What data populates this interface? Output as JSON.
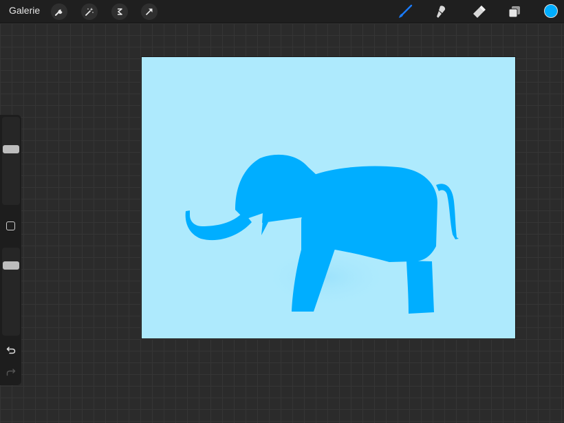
{
  "topbar": {
    "gallery_label": "Galerie",
    "left_tools": [
      "wrench-icon",
      "magic-wand-icon",
      "selection-icon",
      "transform-arrow-icon"
    ],
    "right_tools": [
      "brush-icon",
      "smudge-icon",
      "eraser-icon",
      "layers-icon"
    ],
    "active_tool": "brush-icon"
  },
  "colors": {
    "current_color": "#00aeff",
    "canvas_background": "#aeeafd",
    "elephant": "#00aeff",
    "active_tool": "#1a7cff"
  },
  "sidebar": {
    "brush_size_level": 0.65,
    "opacity_level": 0.83,
    "controls": [
      "modify-button",
      "undo-icon",
      "redo-icon"
    ],
    "redo_enabled": false
  },
  "canvas": {
    "subject": "elephant-silhouette"
  }
}
